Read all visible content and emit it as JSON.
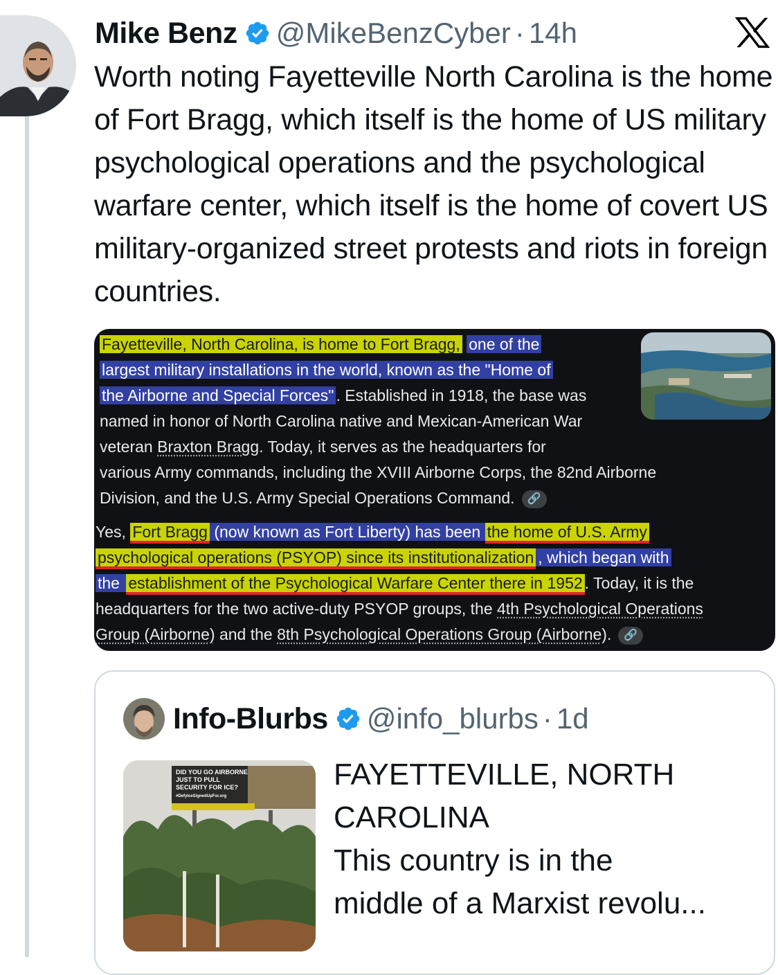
{
  "tweet": {
    "author_name": "Mike Benz",
    "author_handle": "@MikeBenzCyber",
    "separator": "·",
    "time": "14h",
    "text": "Worth noting Fayetteville North Carolina is the home of Fort Bragg, which itself is the home of US military psychological operations and the psychological warfare center, which itself is the home of covert US military-organized street protests and riots in foreign countries.",
    "verified_icon": "verified-badge-icon",
    "brand_icon": "x-logo-icon",
    "colors": {
      "verified": "#1d9bf0",
      "handle": "#536471",
      "thread_line": "#cfd9de"
    }
  },
  "screenshot": {
    "p1": {
      "l1_a": "Fayetteville, North Carolina, is home to Fort Bragg,",
      "l1_b": "one of the",
      "l2": "largest military installations in the world, known as the \"Home of",
      "l3_a": "the Airborne and Special Forces\"",
      "l3_b": ". Established in 1918, the base was",
      "l4": "named in honor of North Carolina native and Mexican-American War",
      "l5_a": "veteran ",
      "l5_b": "Braxton Bragg",
      "l5_c": ". Today, it serves as the headquarters for",
      "l6": "various Army commands, including the XVIII Airborne Corps, the 82nd Airborne",
      "l7": "Division, and the U.S. Army Special Operations Command."
    },
    "p2": {
      "l1_a": "Yes, ",
      "l1_b": "Fort Bragg",
      "l1_c": " (now known as Fort Liberty) has been ",
      "l1_d": "the home of U.S. Army",
      "l2_a": "psychological operations (PSYOP) since its institutionalization",
      "l2_b": ", which began with",
      "l3_a": "the ",
      "l3_b": "establishment of the Psychological Warfare Center there in 1952",
      "l3_c": ". Today, it is the",
      "l4_a": "headquarters for the two active-duty PSYOP groups, the ",
      "l4_b": "4th Psychological Operations",
      "l5_a": "Group (Airborne)",
      "l5_b": " and the ",
      "l5_c": "8th Psychological Operations Group (Airborne)",
      "l5_d": "."
    },
    "link_icon": "link-icon",
    "link_glyph": "🔗",
    "colors": {
      "highlight_yellow": "#c9d400",
      "highlight_blue": "#3240a3",
      "underline_red": "#e0242c",
      "background": "#101114"
    }
  },
  "quote": {
    "author_name": "Info-Blurbs",
    "author_handle": "@info_blurbs",
    "separator": "·",
    "time": "1d",
    "text_line1": "FAYETTEVILLE, NORTH",
    "text_line2": "CAROLINA",
    "text_line3": "This country is in the",
    "text_line4": "middle of a Marxist revolu...",
    "billboard_text": "DID YOU GO AIRBORNE JUST TO PULL SECURITY FOR ICE?",
    "billboard_url": "#DefyIceSignedUpFor.org"
  }
}
